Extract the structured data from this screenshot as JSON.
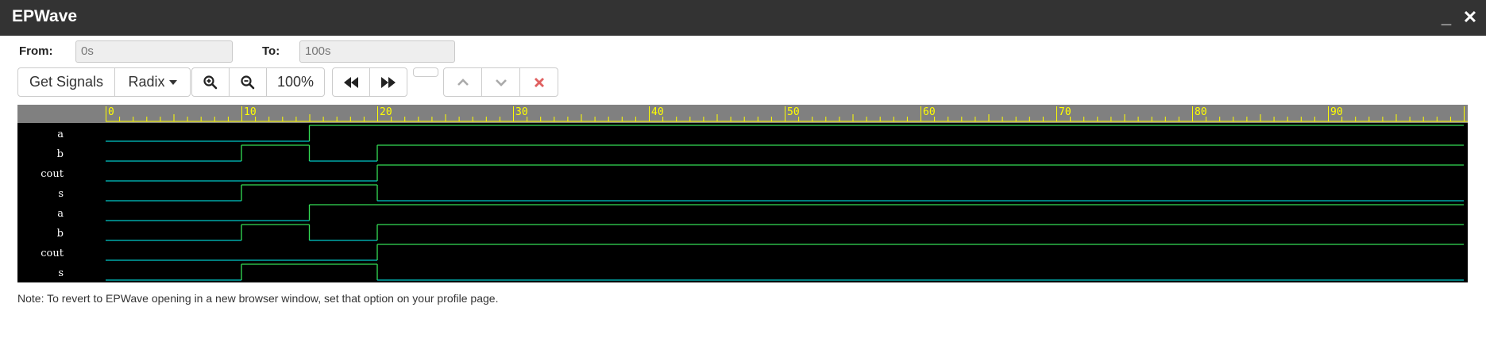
{
  "window": {
    "title": "EPWave",
    "minimize": "_",
    "close": "✕"
  },
  "range": {
    "from_label": "From:",
    "from_value": "0s",
    "to_label": "To:",
    "to_value": "100s"
  },
  "toolbar": {
    "get_signals": "Get Signals",
    "radix": "Radix",
    "zoom_level": "100%"
  },
  "timeline": {
    "ticks": [
      "0",
      "10",
      "20",
      "30",
      "40",
      "50",
      "60",
      "70",
      "80",
      "90"
    ],
    "range": [
      0,
      100
    ]
  },
  "signals": [
    {
      "name": "a",
      "values": [
        [
          0,
          0
        ],
        [
          15,
          1
        ]
      ]
    },
    {
      "name": "b",
      "values": [
        [
          0,
          0
        ],
        [
          10,
          1
        ],
        [
          15,
          0
        ],
        [
          20,
          1
        ]
      ]
    },
    {
      "name": "cout",
      "values": [
        [
          0,
          0
        ],
        [
          20,
          1
        ]
      ]
    },
    {
      "name": "s",
      "values": [
        [
          0,
          0
        ],
        [
          10,
          1
        ],
        [
          20,
          0
        ]
      ]
    },
    {
      "name": "a",
      "values": [
        [
          0,
          0
        ],
        [
          15,
          1
        ]
      ]
    },
    {
      "name": "b",
      "values": [
        [
          0,
          0
        ],
        [
          10,
          1
        ],
        [
          15,
          0
        ],
        [
          20,
          1
        ]
      ]
    },
    {
      "name": "cout",
      "values": [
        [
          0,
          0
        ],
        [
          20,
          1
        ]
      ]
    },
    {
      "name": "s",
      "values": [
        [
          0,
          0
        ],
        [
          10,
          1
        ],
        [
          20,
          0
        ]
      ]
    }
  ],
  "colors": {
    "low": "#00c8c8",
    "high": "#33dd55",
    "ruler": "#ffff00",
    "ruler_bg": "#808080"
  },
  "note": "Note: To revert to EPWave opening in a new browser window, set that option on your profile page."
}
